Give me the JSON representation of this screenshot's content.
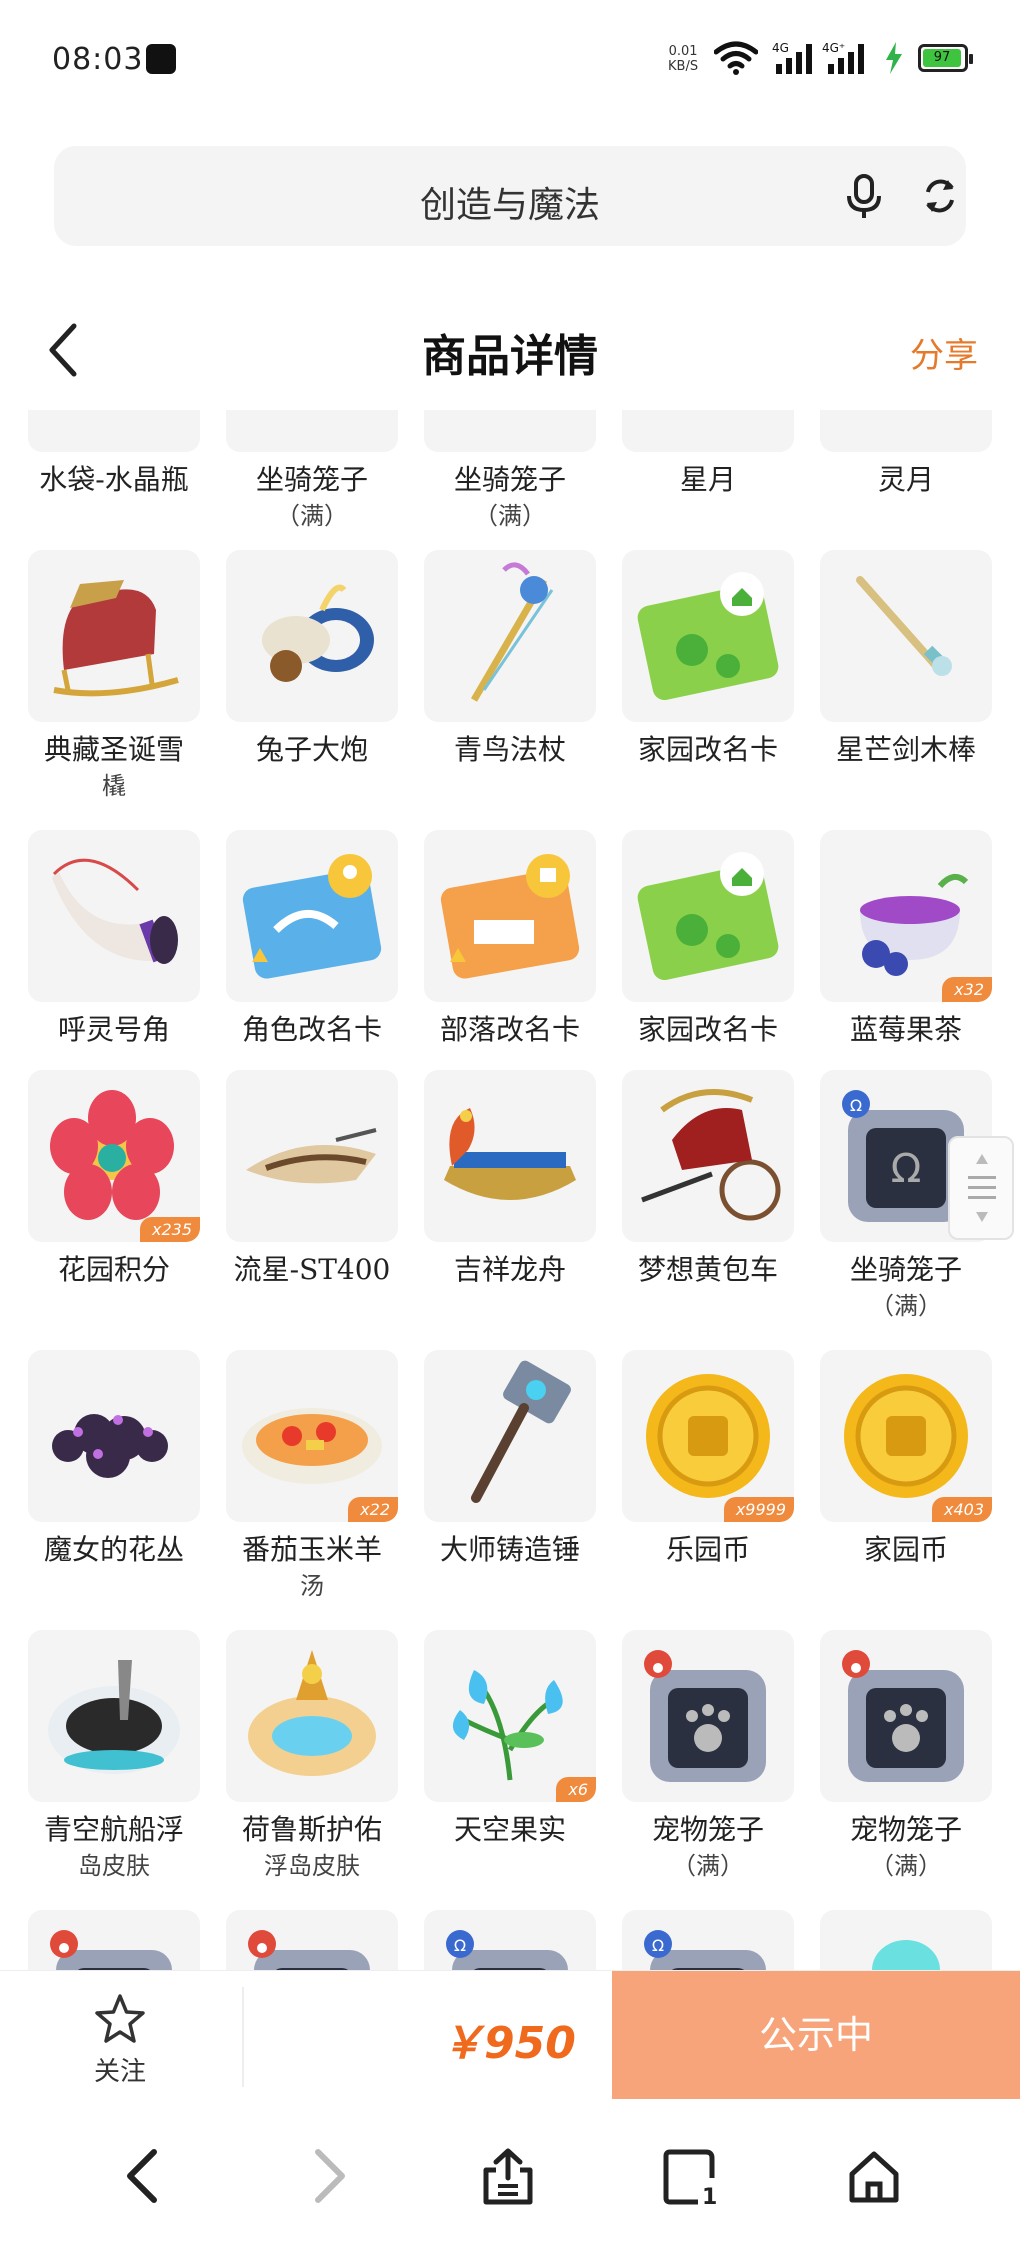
{
  "status": {
    "time": "08:03",
    "net_speed_value": "0.01",
    "net_speed_unit": "KB/S",
    "battery": "97"
  },
  "search": {
    "query": "创造与魔法"
  },
  "header": {
    "title": "商品详情",
    "share": "分享"
  },
  "items": [
    {
      "name": "水袋-水晶瓶",
      "sub": "",
      "badge": "",
      "icon": "partial"
    },
    {
      "name": "坐骑笼子",
      "sub": "（满）",
      "badge": "",
      "icon": "partial"
    },
    {
      "name": "坐骑笼子",
      "sub": "（满）",
      "badge": "",
      "icon": "partial"
    },
    {
      "name": "星月",
      "sub": "",
      "badge": "",
      "icon": "partial"
    },
    {
      "name": "灵月",
      "sub": "",
      "badge": "",
      "icon": "partial"
    },
    {
      "name": "典藏圣诞雪",
      "sub": "橇",
      "badge": "",
      "icon": "sleigh"
    },
    {
      "name": "兔子大炮",
      "sub": "",
      "badge": "",
      "icon": "cannon"
    },
    {
      "name": "青鸟法杖",
      "sub": "",
      "badge": "",
      "icon": "staff"
    },
    {
      "name": "家园改名卡",
      "sub": "",
      "badge": "",
      "icon": "green-card"
    },
    {
      "name": "星芒剑木棒",
      "sub": "",
      "badge": "",
      "icon": "sword"
    },
    {
      "name": "呼灵号角",
      "sub": "",
      "badge": "",
      "icon": "horn"
    },
    {
      "name": "角色改名卡",
      "sub": "",
      "badge": "",
      "icon": "blue-card"
    },
    {
      "name": "部落改名卡",
      "sub": "",
      "badge": "",
      "icon": "orange-card"
    },
    {
      "name": "家园改名卡",
      "sub": "",
      "badge": "",
      "icon": "green-card"
    },
    {
      "name": "蓝莓果茶",
      "sub": "",
      "badge": "x32",
      "icon": "tea"
    },
    {
      "name": "花园积分",
      "sub": "",
      "badge": "x235",
      "icon": "flower"
    },
    {
      "name": "流星-ST400",
      "sub": "",
      "badge": "",
      "icon": "glider"
    },
    {
      "name": "吉祥龙舟",
      "sub": "",
      "badge": "",
      "icon": "dragon-boat"
    },
    {
      "name": "梦想黄包车",
      "sub": "",
      "badge": "",
      "icon": "rickshaw"
    },
    {
      "name": "坐骑笼子",
      "sub": "（满）",
      "badge": "",
      "icon": "cage-mount"
    },
    {
      "name": "魔女的花丛",
      "sub": "",
      "badge": "",
      "icon": "bush"
    },
    {
      "name": "番茄玉米羊",
      "sub": "汤",
      "badge": "x22",
      "icon": "soup"
    },
    {
      "name": "大师铸造锤",
      "sub": "",
      "badge": "",
      "icon": "hammer"
    },
    {
      "name": "乐园币",
      "sub": "",
      "badge": "x9999",
      "icon": "coin"
    },
    {
      "name": "家园币",
      "sub": "",
      "badge": "x403",
      "icon": "coin"
    },
    {
      "name": "青空航船浮",
      "sub": "岛皮肤",
      "badge": "",
      "icon": "island"
    },
    {
      "name": "荷鲁斯护佑",
      "sub": "浮岛皮肤",
      "badge": "",
      "icon": "island-gold"
    },
    {
      "name": "天空果实",
      "sub": "",
      "badge": "x6",
      "icon": "plant"
    },
    {
      "name": "宠物笼子",
      "sub": "（满）",
      "badge": "",
      "icon": "cage-pet"
    },
    {
      "name": "宠物笼子",
      "sub": "（满）",
      "badge": "",
      "icon": "cage-pet"
    }
  ],
  "actionbar": {
    "follow_label": "关注",
    "price": "￥950",
    "publicity_label": "公示中"
  },
  "colors": {
    "accent": "#e47a2c",
    "price": "#f06a1e",
    "cta_bg": "#f7a47b",
    "badge_bg": "#f08a3c"
  }
}
